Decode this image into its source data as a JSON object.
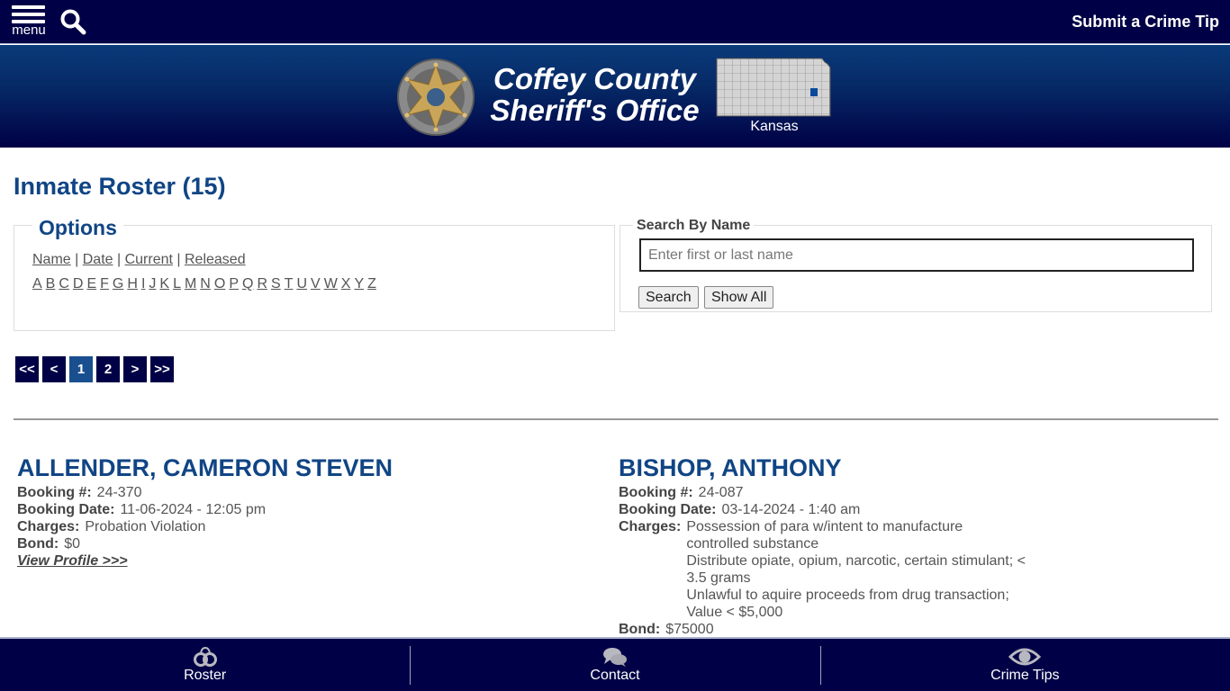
{
  "topbar": {
    "menu_label": "menu",
    "menu_icon": "hamburger-icon",
    "search_icon": "search-icon",
    "tip_link": "Submit a Crime Tip"
  },
  "banner": {
    "title_line1": "Coffey County",
    "title_line2": "Sheriff's Office",
    "badge_icon": "sheriff-star-badge-icon",
    "map_icon": "kansas-map-icon",
    "state_label": "Kansas",
    "colors": {
      "nav_bg": "#000046",
      "accent": "#104585"
    }
  },
  "page": {
    "title": "Inmate Roster (15)"
  },
  "options": {
    "legend": "Options",
    "sort_links": [
      "Name",
      "Date",
      "Current",
      "Released"
    ],
    "letters": [
      "A",
      "B",
      "C",
      "D",
      "E",
      "F",
      "G",
      "H",
      "I",
      "J",
      "K",
      "L",
      "M",
      "N",
      "O",
      "P",
      "Q",
      "R",
      "S",
      "T",
      "U",
      "V",
      "W",
      "X",
      "Y",
      "Z"
    ]
  },
  "search": {
    "legend": "Search By Name",
    "placeholder": "Enter first or last name",
    "value": "",
    "search_button": "Search",
    "show_all_button": "Show All"
  },
  "pagination": {
    "items": [
      "<<",
      "<",
      "1",
      "2",
      ">",
      ">>"
    ],
    "current": "1"
  },
  "inmates": [
    {
      "name": "ALLENDER, CAMERON STEVEN",
      "booking_label": "Booking #:",
      "booking_number": "24-370",
      "date_label": "Booking Date:",
      "booking_date": "11-06-2024 - 12:05 pm",
      "charges_label": "Charges:",
      "charges": "Probation Violation",
      "bond_label": "Bond:",
      "bond": "$0",
      "profile_link": "View Profile >>>"
    },
    {
      "name": "BISHOP, ANTHONY",
      "booking_label": "Booking #:",
      "booking_number": "24-087",
      "date_label": "Booking Date:",
      "booking_date": "03-14-2024 - 1:40 am",
      "charges_label": "Charges:",
      "charges": "Possession of para w/intent to manufacture controlled substance\nDistribute opiate, opium, narcotic, certain stimulant; < 3.5 grams\nUnlawful to aquire proceeds from drug transaction; Value < $5,000",
      "bond_label": "Bond:",
      "bond": "$75000"
    }
  ],
  "bottom_nav": [
    {
      "label": "Roster",
      "icon": "handcuffs-icon"
    },
    {
      "label": "Contact",
      "icon": "chat-bubbles-icon"
    },
    {
      "label": "Crime Tips",
      "icon": "eye-icon"
    }
  ]
}
